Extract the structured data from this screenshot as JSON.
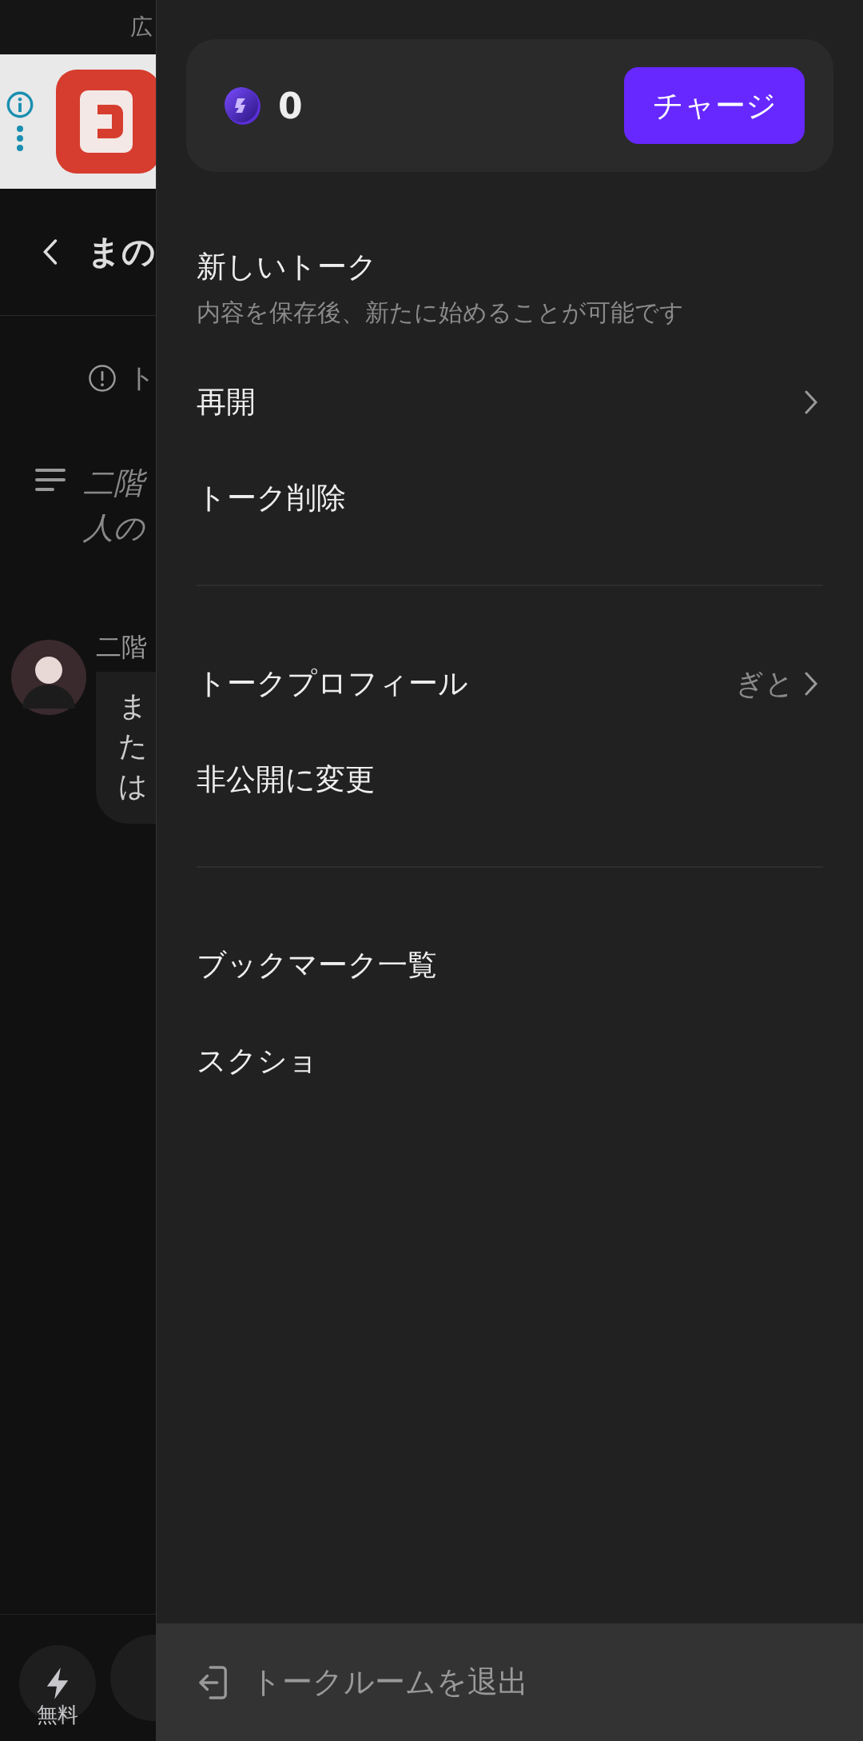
{
  "background": {
    "ad_label": "広",
    "header_title": "まの",
    "notice": "ト",
    "description_lines": [
      "二階",
      "人の"
    ],
    "message": {
      "name": "二階",
      "lines": [
        "ま",
        "た",
        "は"
      ]
    },
    "free_button": "無料"
  },
  "wallet": {
    "balance": "0",
    "charge_button": "チャージ"
  },
  "menu_sections": [
    {
      "items": [
        {
          "label": "新しいトーク",
          "subtitle": "内容を保存後、新たに始めることが可能です",
          "chevron": false
        },
        {
          "label": "再開",
          "chevron": true
        },
        {
          "label": "トーク削除",
          "chevron": false
        }
      ]
    },
    {
      "items": [
        {
          "label": "トークプロフィール",
          "value": "ぎと",
          "chevron": true
        },
        {
          "label": "非公開に変更",
          "chevron": false
        }
      ]
    },
    {
      "items": [
        {
          "label": "ブックマーク一覧",
          "chevron": false
        },
        {
          "label": "スクショ",
          "chevron": false
        }
      ]
    }
  ],
  "exit_button": "トークルームを退出"
}
